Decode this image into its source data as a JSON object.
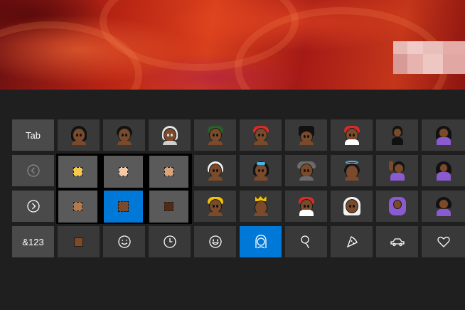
{
  "keyboard": {
    "tab_label": "Tab",
    "numbers_label": "&123"
  },
  "colors": {
    "key_bg": "#393939",
    "key_bg_light": "#4a4a4a",
    "accent": "#0078d7",
    "keyboard_bg": "#1f1f1f",
    "skin_tones": [
      "#f7c84a",
      "#f3c9a8",
      "#d8a47a",
      "#b37a4f",
      "#7a4a2a",
      "#4e2c18"
    ]
  },
  "skin_tone_picker": {
    "options": [
      "yellow",
      "light",
      "medium-light",
      "medium",
      "medium-dark",
      "dark"
    ],
    "selected": "medium-dark"
  },
  "category_bar": {
    "items": [
      {
        "name": "skin-tone-icon"
      },
      {
        "name": "smiley-icon"
      },
      {
        "name": "clock-icon"
      },
      {
        "name": "emoji-face-icon"
      },
      {
        "name": "people-icon",
        "selected": true
      },
      {
        "name": "balloon-icon"
      },
      {
        "name": "pizza-icon"
      },
      {
        "name": "car-icon"
      },
      {
        "name": "heart-icon"
      }
    ]
  },
  "emoji_grid": {
    "row1": [
      "woman",
      "man",
      "old-woman",
      "person-with-cap",
      "rescue-worker",
      "guard",
      "santa",
      "man-in-tuxedo",
      "person-tipping-hand"
    ],
    "row2": [
      "old-man",
      "person-with-tiara",
      "detective",
      "angel",
      "person-raising-hand",
      "person-gesturing-ok"
    ],
    "row3": [
      "construction-worker",
      "prince",
      "santa-claus",
      "bride-with-veil",
      "person-gesturing-ok-purple",
      "person-getting-haircut"
    ]
  }
}
